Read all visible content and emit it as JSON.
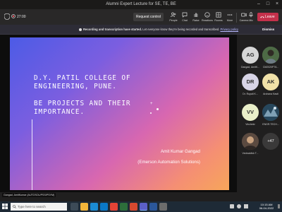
{
  "window": {
    "title": "Alumni Expert Lecture for SE, TE, BE"
  },
  "toolbar": {
    "timer": "27:00",
    "request_control": "Request control",
    "buttons": [
      {
        "icon": "people-icon",
        "label": "People"
      },
      {
        "icon": "chat-icon",
        "label": "Chat"
      },
      {
        "icon": "raise-hand-icon",
        "label": "Raise"
      },
      {
        "icon": "reactions-icon",
        "label": "Reactions"
      },
      {
        "icon": "rooms-icon",
        "label": "Rooms"
      },
      {
        "icon": "more-icon",
        "label": "More"
      },
      {
        "icon": "camera-icon",
        "label": "Camera"
      },
      {
        "icon": "mic-icon",
        "label": "Mic"
      },
      {
        "icon": "share-icon",
        "label": "Share"
      }
    ],
    "leave": "Leave"
  },
  "banner": {
    "bold": "Recording and transcription have started.",
    "text": "Let everyone know they're being recorded and transcribed.",
    "link": "Privacy policy",
    "dismiss": "Dismiss"
  },
  "slide": {
    "title_line1": "D.Y. PATIL COLLEGE OF",
    "title_line2": "ENGINEERING, PUNE.",
    "sub_line1": "BE PROJECTS AND THEIR",
    "sub_line2": "IMPORTANCE.",
    "presenter": "Amit Kumar Gangad",
    "organization": "(Emerson Automation Solutions)"
  },
  "presenter_tag": "Gangad, AmitKumar (AUTOSOL/PSS/PSYM)",
  "participants": [
    {
      "initials": "AG",
      "label": "Gangad, AmitK...",
      "bg": "#d6d6d6",
      "kind": "initials"
    },
    {
      "initials": "",
      "label": "CM2020P76...",
      "bg": "#5a6b4f",
      "kind": "photo"
    },
    {
      "initials": "DR",
      "label": "Dr. Rupali K...",
      "bg": "#d7d4e6",
      "kind": "initials"
    },
    {
      "initials": "AK",
      "label": "Archana Kasti",
      "bg": "#f0e1a8",
      "kind": "initials"
    },
    {
      "initials": "VV",
      "label": "Vinchekr",
      "bg": "#e9efc9",
      "kind": "initials"
    },
    {
      "initials": "",
      "label": "ENGR.TECH...",
      "bg": "#3f5f73",
      "kind": "photo"
    },
    {
      "initials": "",
      "label": "Vedraddivk T...",
      "bg": "#4b3f3a",
      "kind": "photo"
    }
  ],
  "more_count": "+47",
  "taskbar": {
    "search_placeholder": "Type here to search",
    "time": "10:15 AM",
    "date": "06-04-2022"
  },
  "colors": {
    "leave": "#c4314b",
    "banner_bg": "#2d2c36",
    "taskbar_bg": "#1e2a36"
  }
}
